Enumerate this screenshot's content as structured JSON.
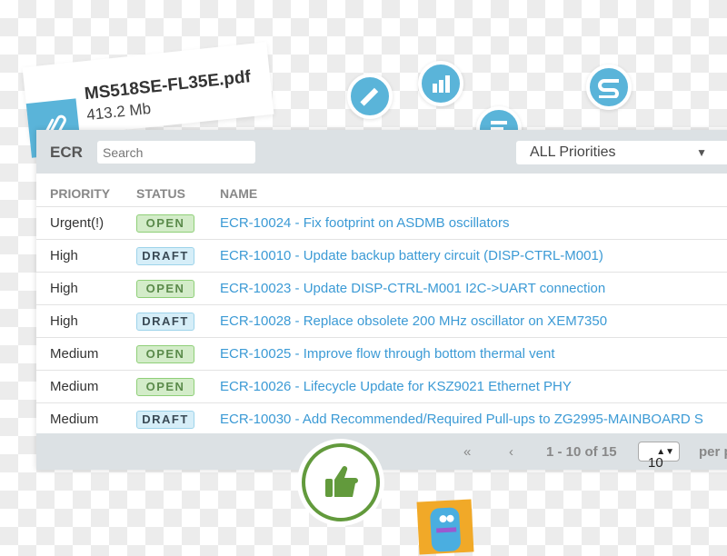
{
  "file": {
    "name": "MS518SE-FL35E.pdf",
    "size": "413.2 Mb",
    "icon": "paperclip-icon"
  },
  "floating_icons": [
    "pencil-icon",
    "bar-chart-icon",
    "list-icon",
    "s-logo-icon",
    "thumbs-up-icon",
    "robot-avatar"
  ],
  "colors": {
    "accent": "#5ab4d9",
    "link": "#3b9ad5",
    "thumb": "#629a3c",
    "open": "#d3ecc9",
    "draft": "#d6eef8"
  },
  "header": {
    "title": "ECR",
    "search_placeholder": "Search",
    "priority_filter": "ALL Priorities"
  },
  "table": {
    "columns": [
      "PRIORITY",
      "STATUS",
      "NAME"
    ],
    "rows": [
      {
        "priority": "Urgent(!)",
        "status": "OPEN",
        "name": "ECR-10024 - Fix footprint on ASDMB oscillators"
      },
      {
        "priority": "High",
        "status": "DRAFT",
        "name": "ECR-10010 - Update backup battery circuit (DISP-CTRL-M001)"
      },
      {
        "priority": "High",
        "status": "OPEN",
        "name": "ECR-10023 - Update DISP-CTRL-M001 I2C->UART connection"
      },
      {
        "priority": "High",
        "status": "DRAFT",
        "name": "ECR-10028 - Replace obsolete 200 MHz oscillator on XEM7350"
      },
      {
        "priority": "Medium",
        "status": "OPEN",
        "name": "ECR-10025 - Improve flow through bottom thermal vent"
      },
      {
        "priority": "Medium",
        "status": "OPEN",
        "name": "ECR-10026 - Lifecycle Update for KSZ9021 Ethernet PHY"
      },
      {
        "priority": "Medium",
        "status": "DRAFT",
        "name": "ECR-10030 - Add Recommended/Required Pull-ups to ZG2995-MAINBOARD S"
      }
    ]
  },
  "pager": {
    "first": "«",
    "prev": "‹",
    "range": "1 - 10 of 15",
    "per_page": "10",
    "per_page_label": "per p"
  }
}
